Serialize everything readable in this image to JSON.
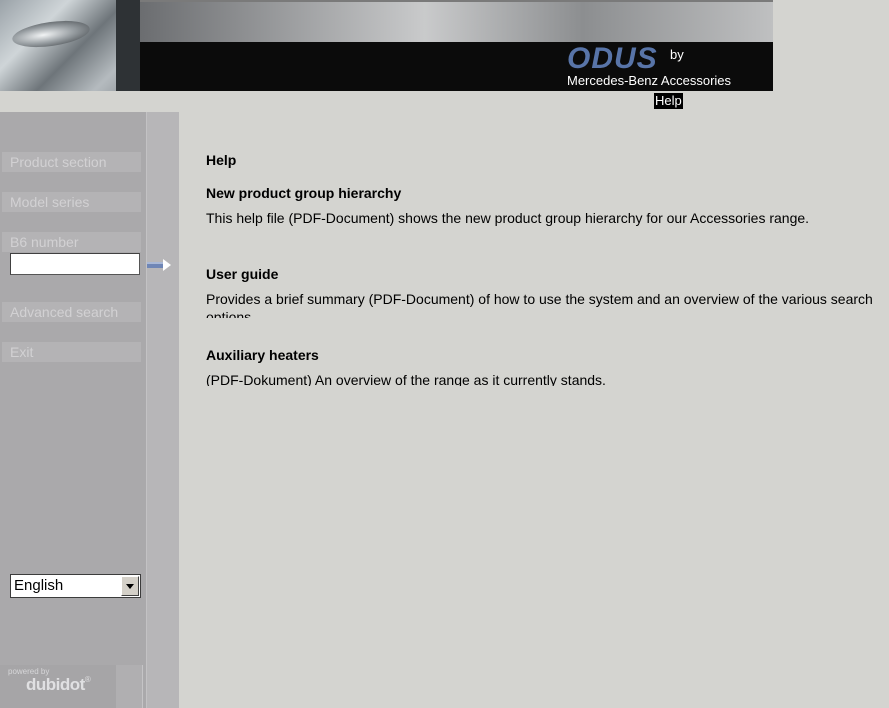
{
  "header": {
    "brand": "ODUS",
    "by": "by",
    "subtitle": "Mercedes-Benz Accessories"
  },
  "topnav": {
    "help": "Help"
  },
  "sidebar": {
    "product_section": "Product section",
    "model_series": "Model series",
    "b6_label": "B6 number",
    "b6_value": "",
    "advanced_search": "Advanced search",
    "exit": "Exit",
    "language": "English",
    "powered_by": "powered by",
    "powered_brand": "dubidot"
  },
  "main": {
    "title": "Help",
    "sections": [
      {
        "heading": "New product group hierarchy",
        "text": "This help file (PDF-Document) shows the new product group hierarchy for our Accessories range."
      },
      {
        "heading": "User guide",
        "text": "Provides a brief summary (PDF-Document) of how to use the system and an overview of the various search options"
      },
      {
        "heading": "Auxiliary heaters",
        "text": "(PDF-Dokument)  An overview of the range as it currently stands."
      }
    ]
  },
  "colors": {
    "brand_blue": "#5874a8",
    "sidebar": "#aaa9ab",
    "background": "#d4d4d0"
  }
}
